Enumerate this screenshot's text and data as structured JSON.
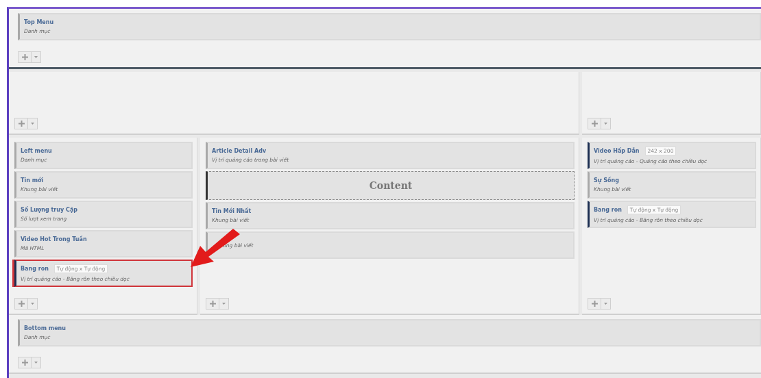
{
  "top_section": {
    "modules": [
      {
        "kind": "module",
        "title": "Top Menu",
        "description": "Danh mục",
        "highlighted": false
      }
    ]
  },
  "columns": [
    {
      "modules": [
        {
          "kind": "module",
          "title": "Left menu",
          "description": "Danh mục",
          "highlighted": false
        },
        {
          "kind": "module",
          "title": "Tin mới",
          "description": "Khung bài viết",
          "highlighted": false
        },
        {
          "kind": "module",
          "title": "Số Lượng truy Cập",
          "description": "Số lượt xem trang",
          "highlighted": false
        },
        {
          "kind": "module",
          "title": "Video Hot Trong Tuần",
          "description": "Mã HTML",
          "highlighted": false
        },
        {
          "kind": "ad",
          "title": "Bang ron",
          "tag": "Tự động x Tự động",
          "description": "Vị trí quảng cáo - Băng rôn theo chiều dọc",
          "highlighted": true
        }
      ]
    },
    {
      "modules": [
        {
          "kind": "module",
          "title": "Article Detail Adv",
          "description": "Vị trí quảng cáo trong bài viết",
          "highlighted": false
        },
        {
          "kind": "content",
          "title": "Content"
        },
        {
          "kind": "module",
          "title": "Tin Mới Nhất",
          "description": "Khung bài viết",
          "highlighted": false
        },
        {
          "kind": "module",
          "description": "ung bài viết",
          "highlighted": false
        }
      ]
    },
    {
      "modules": [
        {
          "kind": "ad",
          "title": "Video Hấp Dẫn",
          "tag": "242 x 200",
          "description": "Vị trí quảng cáo - Quảng cáo theo chiều dọc",
          "highlighted": false
        },
        {
          "kind": "module",
          "title": "Sự Sống",
          "description": "Khung bài viết",
          "highlighted": false
        },
        {
          "kind": "ad",
          "title": "Bang ron",
          "tag": "Tự động x Tự động",
          "description": "Vị trí quảng cáo - Băng rôn theo chiều dọc",
          "highlighted": false
        }
      ]
    }
  ],
  "bottom_section": {
    "modules": [
      {
        "kind": "module",
        "title": "Bottom menu",
        "description": "Danh mục",
        "highlighted": false
      }
    ]
  }
}
